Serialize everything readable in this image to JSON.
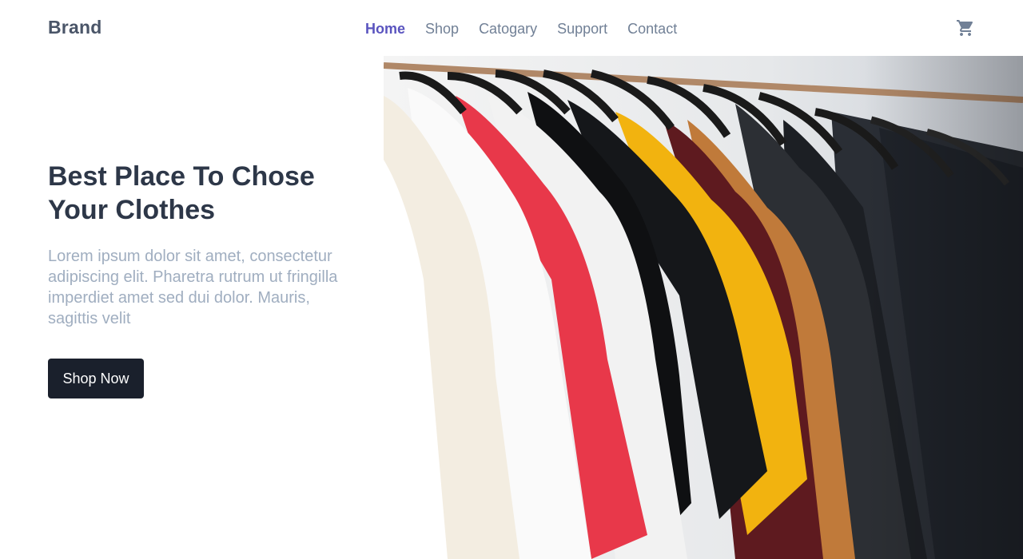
{
  "nav": {
    "brand": "Brand",
    "links": [
      {
        "label": "Home",
        "active": true
      },
      {
        "label": "Shop",
        "active": false
      },
      {
        "label": "Catogary",
        "active": false
      },
      {
        "label": "Support",
        "active": false
      },
      {
        "label": "Contact",
        "active": false
      }
    ],
    "cart_icon": "shopping-cart-icon"
  },
  "hero": {
    "title": "Best Place To Chose Your Clothes",
    "text": "Lorem ipsum dolor sit amet, consectetur adipiscing elit. Pharetra rutrum ut fringilla imperdiet amet sed dui dolor. Mauris, sagittis velit",
    "button_label": "Shop Now",
    "image_subject": "t-shirts hanging on a clothes rail"
  },
  "colors": {
    "accent": "#5a54bf",
    "brand_text": "#4a5568",
    "heading": "#2d3748",
    "body_text": "#a0aec0",
    "button_bg": "#1a202c",
    "button_text": "#ffffff"
  }
}
